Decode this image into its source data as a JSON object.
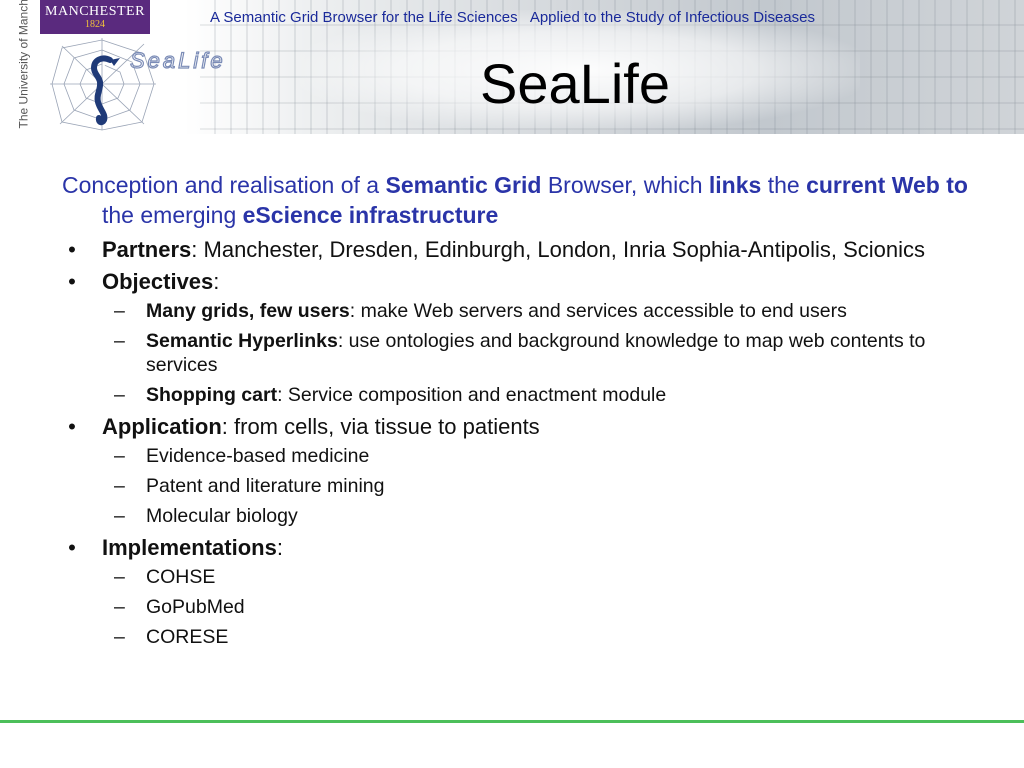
{
  "header": {
    "logo_text": "MANCHESTER",
    "logo_year": "1824",
    "university_vertical": "The University of Manchester",
    "sealife_logo": "SeaLife",
    "tagline_left": "A Semantic Grid Browser for the Life Sciences",
    "tagline_right": "Applied to the Study of Infectious Diseases",
    "title": "SeaLife"
  },
  "intro": {
    "p1": "Conception and realisation of a ",
    "b1": "Semantic Grid",
    "p2": " Browser, which ",
    "b2": "links",
    "p3": " the ",
    "b3": "current Web to",
    "p4": " the emerging ",
    "b4": "eScience infrastructure"
  },
  "bullet_glyph": "•",
  "dash_glyph": "–",
  "partners": {
    "label": "Partners",
    "text": ": Manchester, Dresden, Edinburgh, London, Inria Sophia-Antipolis, Scionics"
  },
  "objectives": {
    "label": "Objectives",
    "suffix": ":",
    "items": [
      {
        "label": "Many grids, few users",
        "text": ": make Web servers and services accessible to end users"
      },
      {
        "label": "Semantic Hyperlinks",
        "text": ": use ontologies and background knowledge to map web contents to services"
      },
      {
        "label": "Shopping cart",
        "text": ": Service composition and enactment module"
      }
    ]
  },
  "application": {
    "label": "Application",
    "text": ": from cells, via tissue to patients",
    "items": [
      "Evidence-based medicine",
      "Patent and literature mining",
      "Molecular biology"
    ]
  },
  "implementations": {
    "label": "Implementations",
    "suffix": ":",
    "items": [
      "COHSE",
      "GoPubMed",
      "CORESE"
    ]
  },
  "colors": {
    "accent_blue": "#2a34a8",
    "header_blue": "#1a2a9a",
    "manchester_purple": "#5a2a7e",
    "manchester_gold": "#f3c23a",
    "footer_green": "#4cbf5a"
  }
}
